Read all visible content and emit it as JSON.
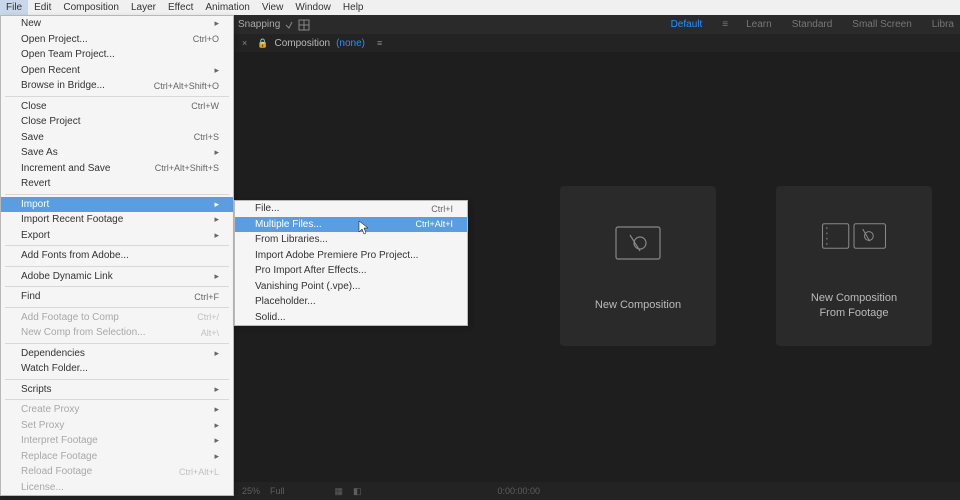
{
  "menubar": [
    "File",
    "Edit",
    "Composition",
    "Layer",
    "Effect",
    "Animation",
    "View",
    "Window",
    "Help"
  ],
  "activeMenu": 0,
  "toolbar": {
    "snapping": "Snapping"
  },
  "workspaces": {
    "default": "Default",
    "learn": "Learn",
    "standard": "Standard",
    "small": "Small Screen",
    "libra": "Libra"
  },
  "compTab": {
    "label": "Composition",
    "none": "(none)"
  },
  "cards": {
    "newComp": "New Composition",
    "fromFootage": "New Composition\nFrom Footage"
  },
  "fileMenu": [
    {
      "t": "item",
      "label": "New",
      "arrow": true
    },
    {
      "t": "item",
      "label": "Open Project...",
      "sc": "Ctrl+O"
    },
    {
      "t": "item",
      "label": "Open Team Project..."
    },
    {
      "t": "item",
      "label": "Open Recent",
      "arrow": true
    },
    {
      "t": "item",
      "label": "Browse in Bridge...",
      "sc": "Ctrl+Alt+Shift+O"
    },
    {
      "t": "sep"
    },
    {
      "t": "item",
      "label": "Close",
      "sc": "Ctrl+W"
    },
    {
      "t": "item",
      "label": "Close Project"
    },
    {
      "t": "item",
      "label": "Save",
      "sc": "Ctrl+S"
    },
    {
      "t": "item",
      "label": "Save As",
      "arrow": true
    },
    {
      "t": "item",
      "label": "Increment and Save",
      "sc": "Ctrl+Alt+Shift+S"
    },
    {
      "t": "item",
      "label": "Revert"
    },
    {
      "t": "sep"
    },
    {
      "t": "item",
      "label": "Import",
      "arrow": true,
      "sel": true
    },
    {
      "t": "item",
      "label": "Import Recent Footage",
      "arrow": true
    },
    {
      "t": "item",
      "label": "Export",
      "arrow": true
    },
    {
      "t": "sep"
    },
    {
      "t": "item",
      "label": "Add Fonts from Adobe..."
    },
    {
      "t": "sep"
    },
    {
      "t": "item",
      "label": "Adobe Dynamic Link",
      "arrow": true
    },
    {
      "t": "sep"
    },
    {
      "t": "item",
      "label": "Find",
      "sc": "Ctrl+F"
    },
    {
      "t": "sep"
    },
    {
      "t": "item",
      "label": "Add Footage to Comp",
      "sc": "Ctrl+/",
      "dis": true
    },
    {
      "t": "item",
      "label": "New Comp from Selection...",
      "sc": "Alt+\\",
      "dis": true
    },
    {
      "t": "sep"
    },
    {
      "t": "item",
      "label": "Dependencies",
      "arrow": true
    },
    {
      "t": "item",
      "label": "Watch Folder..."
    },
    {
      "t": "sep"
    },
    {
      "t": "item",
      "label": "Scripts",
      "arrow": true
    },
    {
      "t": "sep"
    },
    {
      "t": "item",
      "label": "Create Proxy",
      "arrow": true,
      "dis": true
    },
    {
      "t": "item",
      "label": "Set Proxy",
      "arrow": true,
      "dis": true
    },
    {
      "t": "item",
      "label": "Interpret Footage",
      "arrow": true,
      "dis": true
    },
    {
      "t": "item",
      "label": "Replace Footage",
      "arrow": true,
      "dis": true
    },
    {
      "t": "item",
      "label": "Reload Footage",
      "sc": "Ctrl+Alt+L",
      "dis": true
    },
    {
      "t": "item",
      "label": "License...",
      "dis": true
    }
  ],
  "importMenu": [
    {
      "t": "item",
      "label": "File...",
      "sc": "Ctrl+I"
    },
    {
      "t": "item",
      "label": "Multiple Files...",
      "sc": "Ctrl+Alt+I",
      "sel": true
    },
    {
      "t": "item",
      "label": "From Libraries..."
    },
    {
      "t": "item",
      "label": "Import Adobe Premiere Pro Project..."
    },
    {
      "t": "item",
      "label": "Pro Import After Effects..."
    },
    {
      "t": "item",
      "label": "Vanishing Point (.vpe)..."
    },
    {
      "t": "item",
      "label": "Placeholder..."
    },
    {
      "t": "item",
      "label": "Solid..."
    }
  ],
  "footer": {
    "pct": "25%",
    "full": "Full",
    "time": "0:00:00:00"
  }
}
